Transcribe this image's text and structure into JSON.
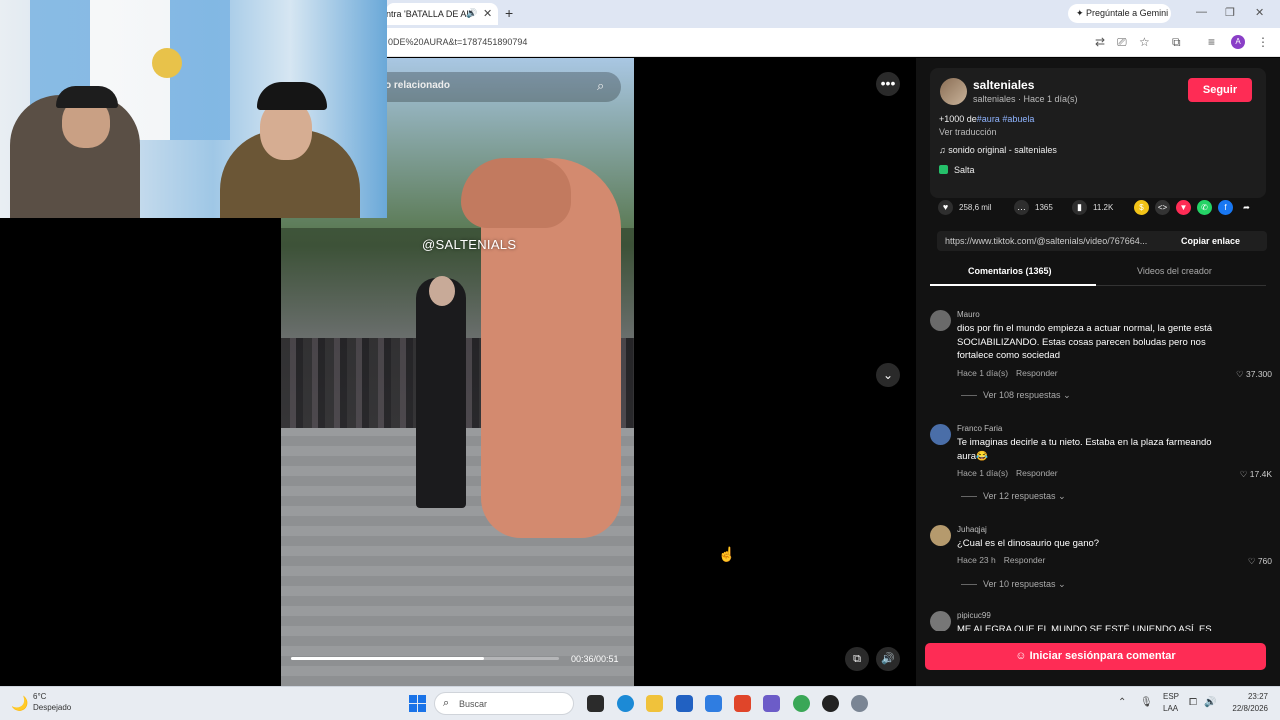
{
  "browser": {
    "tab_title": "ntra 'BATALLA DE AU",
    "url": "0DE%20AURA&t=1787451890794",
    "gemini_label": "Pregúntale a Gemini",
    "profile_initial": "A"
  },
  "video": {
    "search_text": "o relacionado",
    "watermark": "@SALTENIALS",
    "timecode": "00:36/00:51",
    "progress": 0.72
  },
  "author": {
    "username": "salteniales",
    "subline": "salteniales · Hace 1 día(s)",
    "follow_label": "Seguir",
    "desc_prefix": "+1000 de",
    "desc_tags": "#aura #abuela",
    "translate_label": "Ver traducción",
    "music": "sonido original - salteniales",
    "location": "Salta"
  },
  "stats": {
    "likes": "258,6 mil",
    "comments": "1365",
    "saves": "11.2K"
  },
  "share": {
    "link": "https://www.tiktok.com/@saltenials/video/767664...",
    "copy_label": "Copiar enlace"
  },
  "tabs": {
    "comments": "Comentarios (1365)",
    "creator": "Videos del creador"
  },
  "comments": [
    {
      "name": "Mauro",
      "text": "dios por fin el mundo empieza a actuar normal, la gente está SOCIABILIZANDO. Estas cosas parecen boludas pero nos fortalece como sociedad",
      "time": "Hace 1 día(s)",
      "reply_label": "Responder",
      "likes": "37.300",
      "replies": "Ver 108 respuestas"
    },
    {
      "name": "Franco Faria",
      "text": "Te imaginas decirle a tu nieto. Estaba en la plaza farmeando aura😂",
      "time": "Hace 1 día(s)",
      "reply_label": "Responder",
      "likes": "17.4K",
      "replies": "Ver 12 respuestas"
    },
    {
      "name": "Juhaqjaj",
      "text": "¿Cual es el dinosaurio que gano?",
      "time": "Hace 23 h",
      "reply_label": "Responder",
      "likes": "760",
      "replies": "Ver 10 respuestas"
    },
    {
      "name": "pipicuc99",
      "text": "ME ALEGRA QUE EL MUNDO SE ESTÉ UNIENDO ASÍ, ES"
    }
  ],
  "login_button": "Iniciar sesiónpara comentar",
  "taskbar": {
    "temp": "6°C",
    "condition": "Despejado",
    "search_placeholder": "Buscar",
    "lang1": "ESP",
    "lang2": "LAA",
    "time": "23:27",
    "date": "22/8/2026"
  },
  "colors": {
    "accent": "#fe2c55",
    "panel_bg": "#121212",
    "hashtag": "#8fb4ff"
  }
}
